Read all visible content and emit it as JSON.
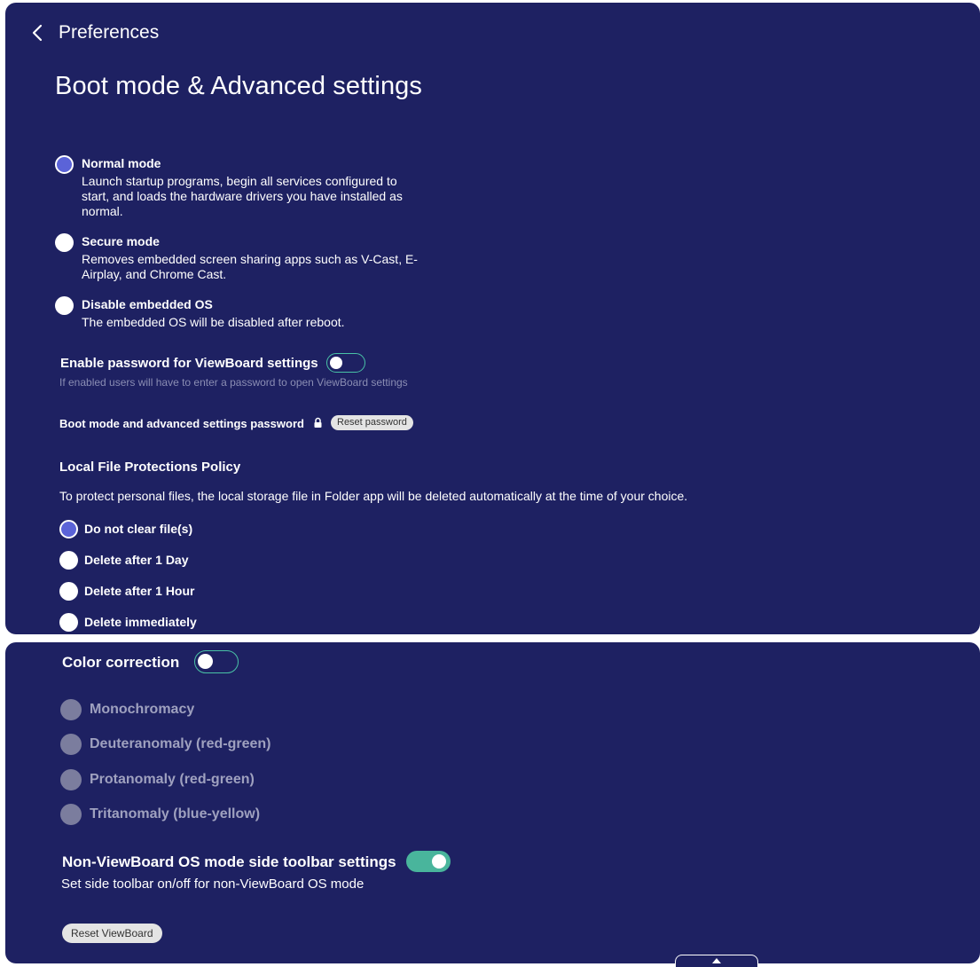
{
  "header": {
    "back_label": "Preferences",
    "title": "Boot mode & Advanced settings"
  },
  "boot_modes": [
    {
      "label": "Normal mode",
      "desc": "Launch startup programs, begin all services configured to start, and loads the hardware drivers you have installed as normal.",
      "selected": true
    },
    {
      "label": "Secure mode",
      "desc": "Removes embedded screen sharing apps such as V-Cast, E-Airplay, and Chrome Cast.",
      "selected": false
    },
    {
      "label": "Disable embedded OS",
      "desc": "The embedded OS will be disabled after reboot.",
      "selected": false
    }
  ],
  "password": {
    "enable_label": "Enable password for ViewBoard settings",
    "enable_hint": "If enabled users will have to enter a password to open ViewBoard settings",
    "enabled": false,
    "boot_password_label": "Boot mode and advanced settings password",
    "reset_button": "Reset password"
  },
  "file_protection": {
    "title": "Local File Protections Policy",
    "desc": "To protect personal files, the local storage file in Folder app will be deleted automatically at the time of your choice.",
    "options": [
      {
        "label": "Do not clear file(s)",
        "selected": true
      },
      {
        "label": "Delete after 1 Day",
        "selected": false
      },
      {
        "label": "Delete after 1 Hour",
        "selected": false
      },
      {
        "label": "Delete immediately",
        "selected": false
      }
    ]
  },
  "color_correction": {
    "label": "Color correction",
    "enabled": false,
    "options": [
      {
        "label": "Monochromacy"
      },
      {
        "label": "Deuteranomaly (red-green)"
      },
      {
        "label": "Protanomaly (red-green)"
      },
      {
        "label": "Tritanomaly (blue-yellow)"
      }
    ]
  },
  "toolbar": {
    "label": "Non-ViewBoard OS mode side toolbar settings",
    "desc": "Set side toolbar on/off for non-ViewBoard OS mode",
    "enabled": true
  },
  "reset_viewboard_label": "Reset ViewBoard",
  "colors": {
    "panel": "#1e2162",
    "accent": "#49b59c",
    "radio_selected": "#5b63d8"
  }
}
